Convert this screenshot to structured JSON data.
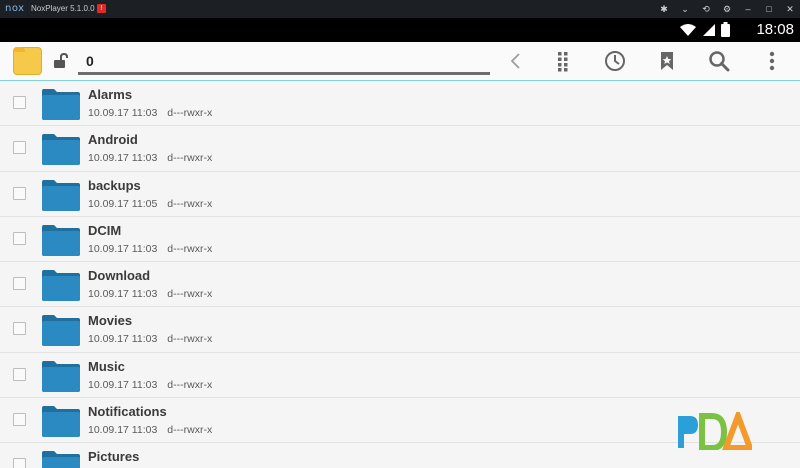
{
  "titlebar": {
    "logo": "nox",
    "title": "NoxPlayer 5.1.0.0",
    "badge": "!",
    "icons": [
      "gamepad-icon",
      "chevron-down-icon",
      "sync-icon",
      "gear-icon",
      "minimize-icon",
      "maximize-icon",
      "close-icon"
    ]
  },
  "statusbar": {
    "time": "18:08"
  },
  "toolbar": {
    "path": "0",
    "icons": [
      "back-arrow-icon",
      "grid-icon",
      "history-icon",
      "bookmark-icon",
      "search-icon",
      "overflow-menu-icon"
    ]
  },
  "files": [
    {
      "name": "Alarms",
      "date": "10.09.17 11:03",
      "perm": "d---rwxr-x"
    },
    {
      "name": "Android",
      "date": "10.09.17 11:03",
      "perm": "d---rwxr-x"
    },
    {
      "name": "backups",
      "date": "10.09.17 11:05",
      "perm": "d---rwxr-x"
    },
    {
      "name": "DCIM",
      "date": "10.09.17 11:03",
      "perm": "d---rwxr-x"
    },
    {
      "name": "Download",
      "date": "10.09.17 11:03",
      "perm": "d---rwxr-x"
    },
    {
      "name": "Movies",
      "date": "10.09.17 11:03",
      "perm": "d---rwxr-x"
    },
    {
      "name": "Music",
      "date": "10.09.17 11:03",
      "perm": "d---rwxr-x"
    },
    {
      "name": "Notifications",
      "date": "10.09.17 11:03",
      "perm": "d---rwxr-x"
    },
    {
      "name": "Pictures",
      "date": "",
      "perm": ""
    }
  ],
  "colors": {
    "accent": "#7fd2de",
    "folder_blue": "#2b8ac1",
    "folder_yellow": "#f6c94b"
  },
  "watermark": "PDA"
}
